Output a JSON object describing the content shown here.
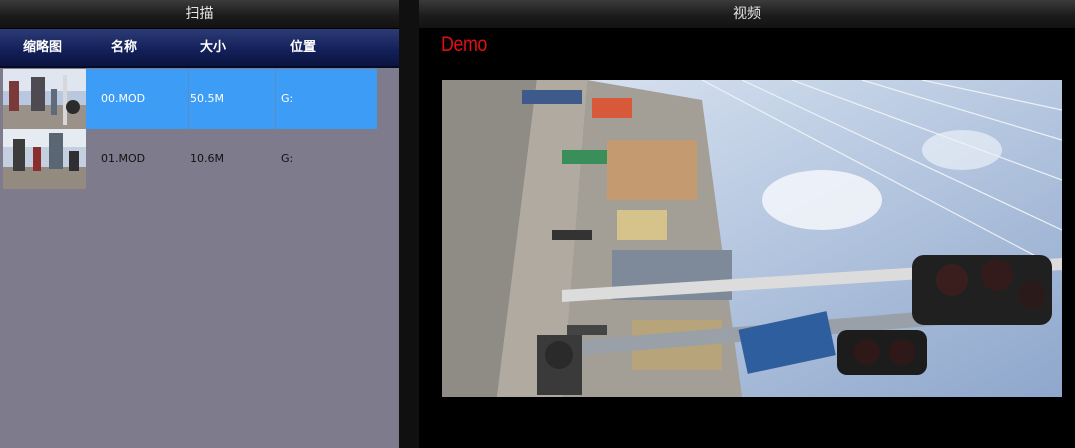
{
  "scan_panel": {
    "title": "扫描",
    "columns": [
      "缩略图",
      "名称",
      "大小",
      "位置"
    ],
    "rows": [
      {
        "name": "00.MOD",
        "size": "50.5M",
        "location": "G:",
        "selected": true
      },
      {
        "name": "01.MOD",
        "size": "10.6M",
        "location": "G:",
        "selected": false
      }
    ]
  },
  "video_panel": {
    "title": "视频",
    "watermark": "Demo",
    "watermark_color": "#e01010"
  },
  "colors": {
    "selection": "#3d9cf5",
    "list_background": "#7e7b8c",
    "header_background": "#14215a"
  }
}
